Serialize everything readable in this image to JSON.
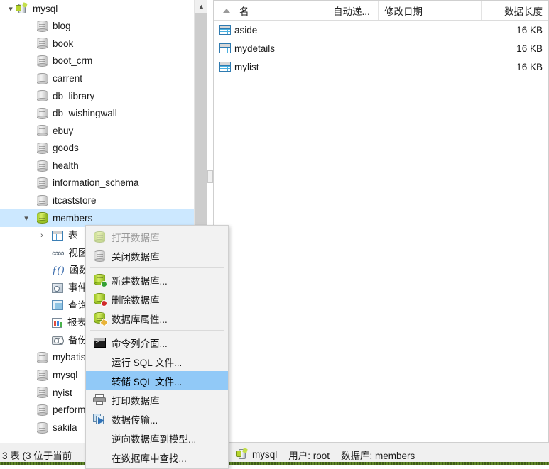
{
  "tree": {
    "connection": {
      "label": "mysql",
      "icon": "connection-icon",
      "expander": "chevron-down-icon"
    },
    "databases": [
      {
        "label": "blog",
        "state": "closed"
      },
      {
        "label": "book",
        "state": "closed"
      },
      {
        "label": "boot_crm",
        "state": "closed"
      },
      {
        "label": "carrent",
        "state": "closed"
      },
      {
        "label": "db_library",
        "state": "closed"
      },
      {
        "label": "db_wishingwall",
        "state": "closed"
      },
      {
        "label": "ebuy",
        "state": "closed"
      },
      {
        "label": "goods",
        "state": "closed"
      },
      {
        "label": "health",
        "state": "closed"
      },
      {
        "label": "information_schema",
        "state": "closed"
      },
      {
        "label": "itcaststore",
        "state": "closed"
      },
      {
        "label": "members",
        "state": "open",
        "selected": true,
        "expander": "chevron-down-icon"
      },
      {
        "label": "mybatis",
        "state": "closed"
      },
      {
        "label": "mysql",
        "state": "closed"
      },
      {
        "label": "nyist",
        "state": "closed"
      },
      {
        "label": "performance_schema",
        "state": "closed"
      },
      {
        "label": "sakila",
        "state": "closed"
      }
    ],
    "members_children": [
      {
        "label": "表",
        "icon": "table-icon",
        "expander": "chevron-right-icon"
      },
      {
        "label": "视图",
        "icon": "view-icon"
      },
      {
        "label": "函数",
        "icon": "function-icon"
      },
      {
        "label": "事件",
        "icon": "event-icon"
      },
      {
        "label": "查询",
        "icon": "query-icon"
      },
      {
        "label": "报表",
        "icon": "report-icon"
      },
      {
        "label": "备份",
        "icon": "backup-icon"
      }
    ]
  },
  "list": {
    "columns": [
      {
        "key": "name",
        "label": "名",
        "sorted": "asc"
      },
      {
        "key": "ai",
        "label": "自动递..."
      },
      {
        "key": "date",
        "label": "修改日期"
      },
      {
        "key": "len",
        "label": "数据长度"
      }
    ],
    "rows": [
      {
        "name": "aside",
        "ai": "",
        "date": "",
        "len": "16 KB"
      },
      {
        "name": "mydetails",
        "ai": "",
        "date": "",
        "len": "16 KB"
      },
      {
        "name": "mylist",
        "ai": "",
        "date": "",
        "len": "16 KB"
      }
    ]
  },
  "context_menu": {
    "items": [
      {
        "label": "打开数据库",
        "icon": "database-open-icon",
        "state": "disabled"
      },
      {
        "label": "关闭数据库",
        "icon": "database-closed-icon",
        "state": "normal"
      },
      {
        "separator": true
      },
      {
        "label": "新建数据库...",
        "icon": "database-add-icon",
        "state": "normal"
      },
      {
        "label": "删除数据库",
        "icon": "database-delete-icon",
        "state": "normal"
      },
      {
        "label": "数据库属性...",
        "icon": "database-edit-icon",
        "state": "normal"
      },
      {
        "separator": true
      },
      {
        "label": "命令列介面...",
        "icon": "console-icon",
        "state": "normal"
      },
      {
        "label": "运行 SQL 文件...",
        "icon": "none",
        "state": "normal"
      },
      {
        "label": "转储 SQL 文件...",
        "icon": "none",
        "state": "highlighted"
      },
      {
        "label": "打印数据库",
        "icon": "printer-icon",
        "state": "normal"
      },
      {
        "label": "数据传输...",
        "icon": "data-transfer-icon",
        "state": "normal"
      },
      {
        "label": "逆向数据库到模型...",
        "icon": "none",
        "state": "normal"
      },
      {
        "label": "在数据库中查找...",
        "icon": "none",
        "state": "normal"
      }
    ]
  },
  "status_bar": {
    "left_text": "3 表 (3 位于当前",
    "connection": "mysql",
    "user": "用户: root",
    "database": "数据库: members"
  },
  "colors": {
    "selection_blue": "#cce8ff",
    "menu_highlight": "#91c9f7",
    "panel_bg": "#f0f0f0",
    "scrollbar_thumb": "#cdcdcd"
  }
}
